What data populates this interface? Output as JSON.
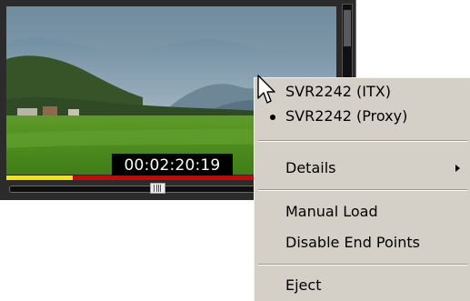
{
  "player": {
    "timecode": "00:02:20:19",
    "progress_fraction": 0.2,
    "scrub_position_fraction": 0.46,
    "colors": {
      "progress_played": "#f5e600",
      "progress_remaining": "#d80000",
      "timecode_bg": "#000000",
      "timecode_text": "#ffffff"
    }
  },
  "context_menu": {
    "items": [
      {
        "label": "SVR2242 (ITX)",
        "selected": false
      },
      {
        "label": "SVR2242 (Proxy)",
        "selected": true
      },
      {
        "label": "Details",
        "has_submenu": true
      },
      {
        "label": "Manual Load"
      },
      {
        "label": "Disable End Points"
      },
      {
        "label": "Eject"
      }
    ],
    "icons": {
      "selected_marker": "bullet-icon",
      "submenu": "submenu-arrow-icon"
    }
  },
  "cursor": {
    "icon": "arrow-pointer-icon"
  }
}
